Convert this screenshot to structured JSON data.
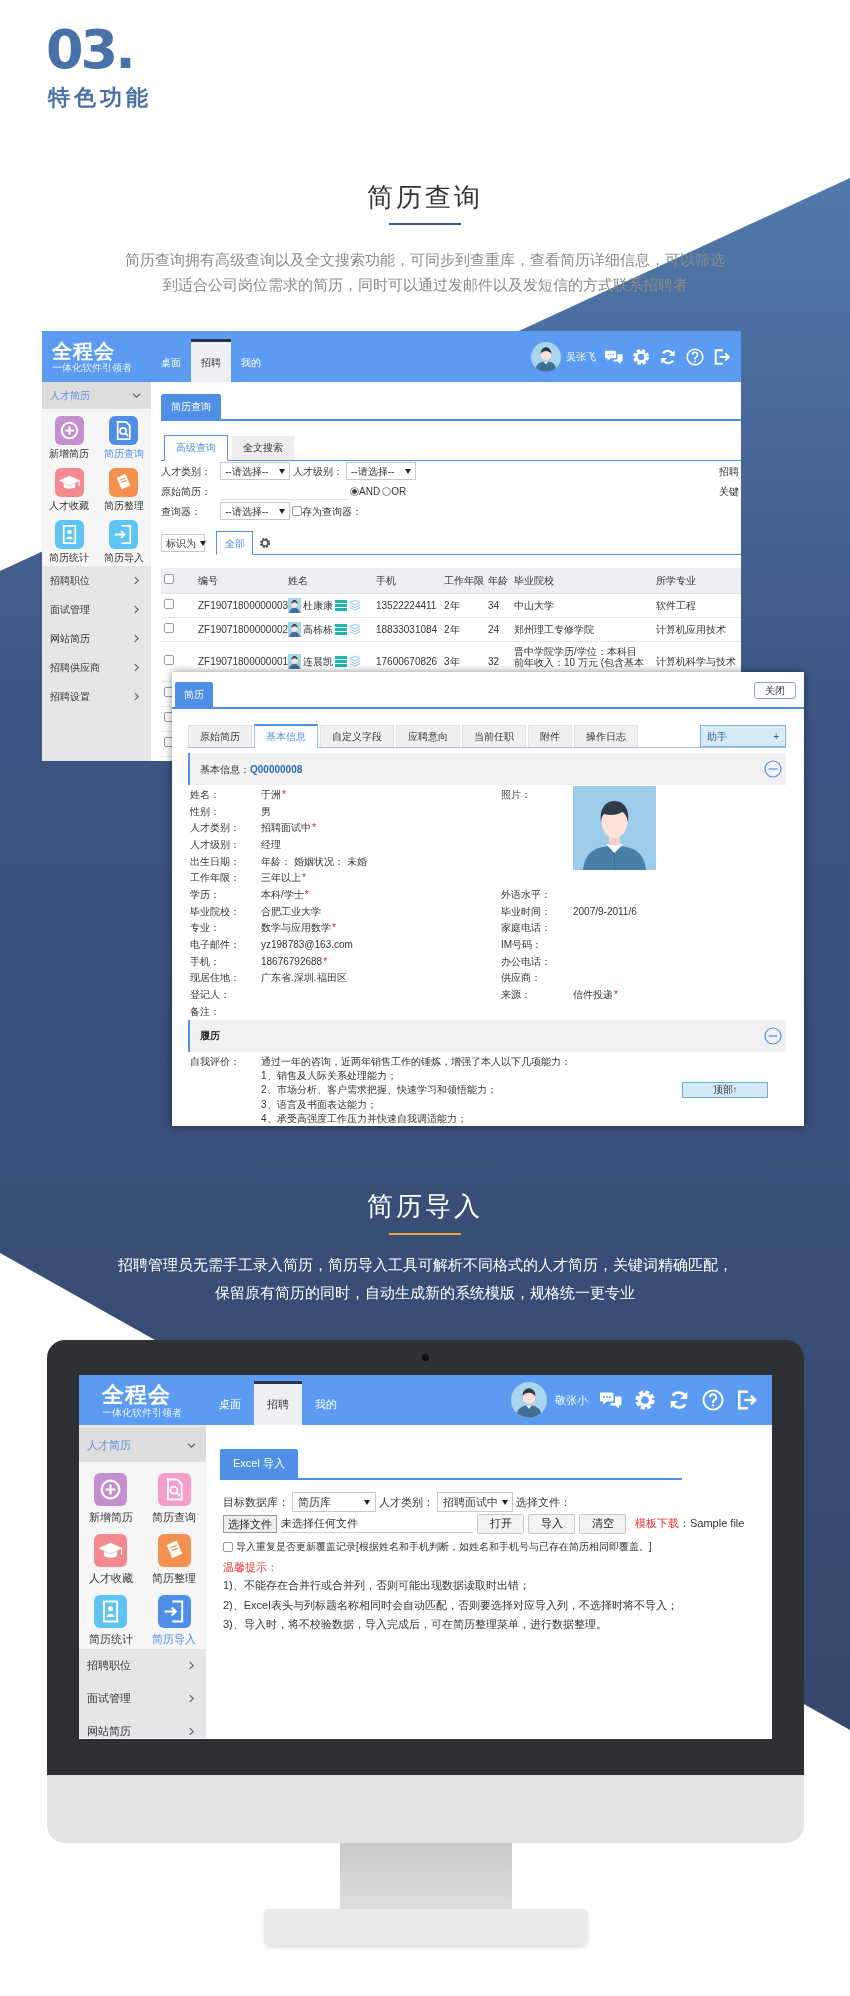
{
  "heading": {
    "number": "03.",
    "title": "特色功能"
  },
  "resume_query": {
    "title": "简历查询",
    "description": [
      "简历查询拥有高级查询以及全文搜索功能，可同步到查重库，查看简历详细信息，可以筛选",
      "到适合公司岗位需求的简历，同时可以通过发邮件以及发短信的方式联系招聘者"
    ],
    "app_window": {
      "logo": "全程会",
      "slogan": "一体化软件引领者",
      "nav_tabs": [
        {
          "label": "桌面",
          "selected": false
        },
        {
          "label": "招聘",
          "selected": true
        },
        {
          "label": "我的",
          "selected": false
        }
      ],
      "user_name": "吴张飞",
      "sidebar": {
        "group": {
          "label": "人才简历",
          "expanded": true
        },
        "shortcuts": [
          {
            "label": "新增简历",
            "color": "#c48fcf",
            "selected": false
          },
          {
            "label": "简历查询",
            "color": "#4f8fe8",
            "selected": true
          },
          {
            "label": "人才收藏",
            "color": "#f48a8f",
            "selected": false
          },
          {
            "label": "简历整理",
            "color": "#f5904f",
            "selected": false
          },
          {
            "label": "简历统计",
            "color": "#5ec4f4",
            "selected": false
          },
          {
            "label": "简历导入",
            "color": "#5ec4f4",
            "selected": false
          }
        ],
        "menu": [
          {
            "label": "招聘职位",
            "expanded": false
          },
          {
            "label": "面试管理",
            "expanded": false
          },
          {
            "label": "网站简历",
            "expanded": false
          },
          {
            "label": "招聘供应商",
            "expanded": false
          },
          {
            "label": "招聘设置",
            "expanded": false
          }
        ]
      },
      "page_tab": "简历查询",
      "search_tabs": [
        {
          "label": "高级查询",
          "selected": true
        },
        {
          "label": "全文搜索",
          "selected": false
        }
      ],
      "query_form": {
        "talent_type": {
          "label": "人才类别：",
          "value": "--请选择--"
        },
        "talent_level": {
          "label": "人才级别：",
          "value": "--请选择--"
        },
        "original_resume": {
          "label": "原始简历："
        },
        "logic": [
          {
            "label": "AND",
            "selected": true
          },
          {
            "label": "OR",
            "selected": false
          }
        ],
        "query_preset": {
          "label": "查询器：",
          "value": "--请选择--"
        },
        "save_preset": {
          "label": "存为查询器：",
          "checked": false
        },
        "right_labels": [
          "招聘",
          "关键"
        ]
      },
      "mark_as": "标识为",
      "list_tabs": [
        {
          "label": "全部",
          "selected": true
        }
      ],
      "table": {
        "select_all": false,
        "columns": [
          "编号",
          "姓名",
          "手机",
          "工作年限",
          "年龄",
          "毕业院校",
          "所学专业"
        ],
        "rows": [
          {
            "checked": false,
            "cells": [
              "ZF19071800000003",
              "杜康康",
              "13522224411",
              "2年",
              "34",
              "中山大学",
              "软件工程"
            ]
          },
          {
            "checked": false,
            "cells": [
              "ZF19071800000002",
              "高栋栋",
              "18833031084",
              "2年",
              "24",
              "郑州理工专修学院",
              "计算机应用技术"
            ]
          },
          {
            "checked": false,
            "cells": [
              "ZF19071800000001",
              "连晨凯",
              "17600670826",
              "3年",
              "32",
              [
                "晋中学院学历/学位：本科目",
                "前年收入：10 万元 (包含基本"
              ],
              "计算机科学与技术"
            ]
          },
          {
            "checked": false
          },
          {
            "checked": false
          },
          {
            "checked": false
          }
        ]
      }
    },
    "resume_dialog": {
      "title": "简历",
      "close_button": "关闭",
      "tabs": [
        {
          "label": "原始简历",
          "selected": false
        },
        {
          "label": "基本信息",
          "selected": true
        },
        {
          "label": "自定义字段",
          "selected": false
        },
        {
          "label": "应聘意向",
          "selected": false
        },
        {
          "label": "当前任职",
          "selected": false
        },
        {
          "label": "附件",
          "selected": false
        },
        {
          "label": "操作日志",
          "selected": false
        }
      ],
      "assistant": {
        "value": "助手",
        "toggle": "+"
      },
      "basic_info": {
        "label": "基本信息：",
        "code": "Q00000008",
        "expanded": true
      },
      "fields": [
        {
          "left": {
            "label": "姓名：",
            "value": "于洲",
            "mark": "*"
          },
          "right": {
            "label": "照片：",
            "kind": "photo"
          }
        },
        {
          "left": {
            "label": "性别：",
            "value": "男"
          }
        },
        {
          "left": {
            "label": "人才类别：",
            "value": "招聘面试中",
            "mark": "*"
          }
        },
        {
          "left": {
            "label": "人才级别：",
            "value": "经理"
          }
        },
        {
          "left": {
            "label": "出生日期：",
            "value": "年龄： 婚姻状况： 未婚"
          }
        },
        {
          "left": {
            "label": "工作年限：",
            "value": "三年以上",
            "mark": "*"
          }
        },
        {
          "left": {
            "label": "学历：",
            "value": "本科/学士",
            "mark": "*"
          },
          "right": {
            "label": "外语水平："
          }
        },
        {
          "left": {
            "label": "毕业院校：",
            "value": "合肥工业大学"
          },
          "right": {
            "label": "毕业时间：",
            "value": "2007/9-2011/6"
          }
        },
        {
          "left": {
            "label": "专业：",
            "value": "数学与应用数学",
            "mark": "*"
          },
          "right": {
            "label": "家庭电话："
          }
        },
        {
          "left": {
            "label": "电子邮件：",
            "value": "yz198783@163.com"
          },
          "right": {
            "label": "IM号码："
          }
        },
        {
          "left": {
            "label": "手机：",
            "value": "18676792688",
            "mark": "*"
          },
          "right": {
            "label": "办公电话："
          }
        },
        {
          "left": {
            "label": "现居住地：",
            "value": "广东省.深圳.福田区"
          },
          "right": {
            "label": "供应商："
          }
        },
        {
          "left": {
            "label": "登记人："
          },
          "right": {
            "label": "来源：",
            "value": "信件投递",
            "mark": "*"
          }
        },
        {
          "left": {
            "label": "备注："
          }
        }
      ],
      "experience": {
        "label": "履历",
        "expanded": true
      },
      "self_evaluation": {
        "label": "自我评价：",
        "lines": [
          "通过一年的咨询，近两年销售工作的锤炼，增强了本人以下几项能力：",
          "1、销售及人际关系处理能力；",
          "2、市场分析、客户需求把握、快速学习和领悟能力；",
          "3、语言及书面表达能力；",
          "4、承受高强度工作压力并快速自我调适能力；"
        ]
      },
      "top_button": "顶部↑"
    }
  },
  "resume_import": {
    "title": "简历导入",
    "description": [
      "招聘管理员无需手工录入简历，简历导入工具可解析不同格式的人才简历，关键词精确匹配，",
      "保留原有简历的同时，自动生成新的系统模版，规格统一更专业"
    ],
    "app_window": {
      "logo": "全程会",
      "slogan": "一体化软件引领者",
      "nav_tabs": [
        {
          "label": "桌面",
          "selected": false
        },
        {
          "label": "招聘",
          "selected": true
        },
        {
          "label": "我的",
          "selected": false
        }
      ],
      "user_name": "敬张小",
      "sidebar": {
        "group": {
          "label": "人才简历",
          "expanded": true
        },
        "shortcuts": [
          {
            "label": "新增简历",
            "color": "#c48fcf",
            "selected": false
          },
          {
            "label": "简历查询",
            "color": "#f59cc9",
            "selected": false
          },
          {
            "label": "人才收藏",
            "color": "#f48a8f",
            "selected": false
          },
          {
            "label": "简历整理",
            "color": "#f5904f",
            "selected": false
          },
          {
            "label": "简历统计",
            "color": "#5ec4f4",
            "selected": false
          },
          {
            "label": "简历导入",
            "color": "#4f8fe8",
            "selected": true
          }
        ],
        "menu": [
          {
            "label": "招聘职位",
            "expanded": false
          },
          {
            "label": "面试管理",
            "expanded": false
          },
          {
            "label": "网站简历",
            "expanded": false
          }
        ]
      },
      "page_tab": "Excel 导入",
      "import_form": {
        "target_db": {
          "label": "目标数据库：",
          "value": "简历库"
        },
        "talent_type": {
          "label": "人才类别：",
          "value": "招聘面试中"
        },
        "file_label": "选择文件：",
        "file_button": "选择文件",
        "file_status": "未选择任何文件",
        "buttons": [
          "打开",
          "导入",
          "清空"
        ],
        "template_link": "模板下载",
        "template_name": "：Sample file",
        "overwrite": {
          "label": "导入重复是否更新覆盖记录[根据姓名和手机判断，如姓名和手机号与已存在简历相同即覆盖。]",
          "checked": false
        },
        "tips_title": "温馨提示：",
        "tips": [
          "1)、不能存在合并行或合并列，否则可能出现数据读取时出错；",
          "2)、Excel表头与列标题名称相同时会自动匹配，否则要选择对应导入列，不选择时将不导入；",
          "3)、导入时，将不校验数据，导入完成后，可在简历整理菜单，进行数据整理。"
        ]
      }
    }
  }
}
